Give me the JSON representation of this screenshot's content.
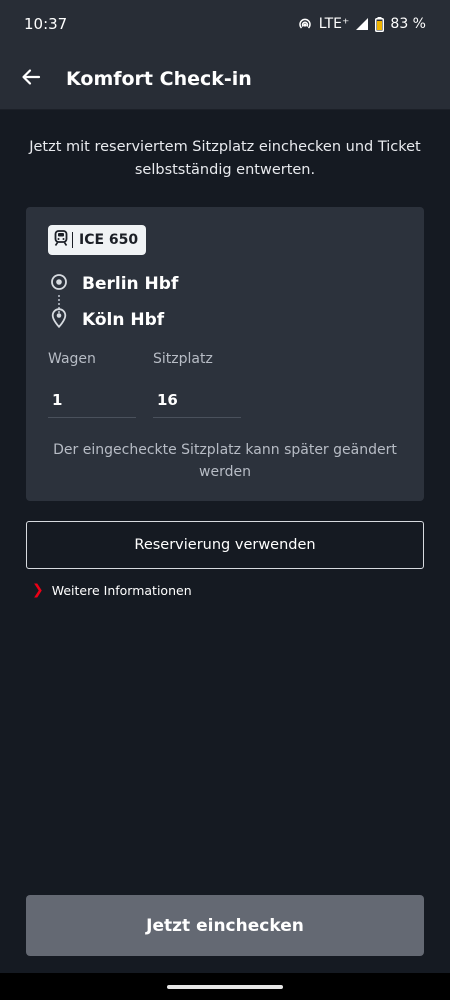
{
  "status_bar": {
    "time": "10:37",
    "network": "LTE⁺",
    "battery": "83 %",
    "icons": [
      "hotspot-icon",
      "signal-icon",
      "battery-icon"
    ]
  },
  "app_bar": {
    "title": "Komfort Check-in",
    "back_icon": "arrow-left-icon"
  },
  "intro_text": "Jetzt mit reserviertem Sitzplatz einchecken und Ticket selbstständig entwerten.",
  "card": {
    "train": "ICE 650",
    "train_icon": "train-icon",
    "origin": "Berlin Hbf",
    "destination": "Köln Hbf",
    "wagen_label": "Wagen",
    "wagen_value": "1",
    "sitzplatz_label": "Sitzplatz",
    "sitzplatz_value": "16",
    "note": "Der eingecheckte Sitzplatz kann später geändert werden"
  },
  "reservation_button": "Reservierung verwenden",
  "more_info_link": "Weitere Informationen",
  "checkin_button": "Jetzt einchecken",
  "colors": {
    "background": "#151a22",
    "bar": "#282d36",
    "card": "#2c323c",
    "accent_red": "#ec0016",
    "disabled_button": "#646973"
  }
}
